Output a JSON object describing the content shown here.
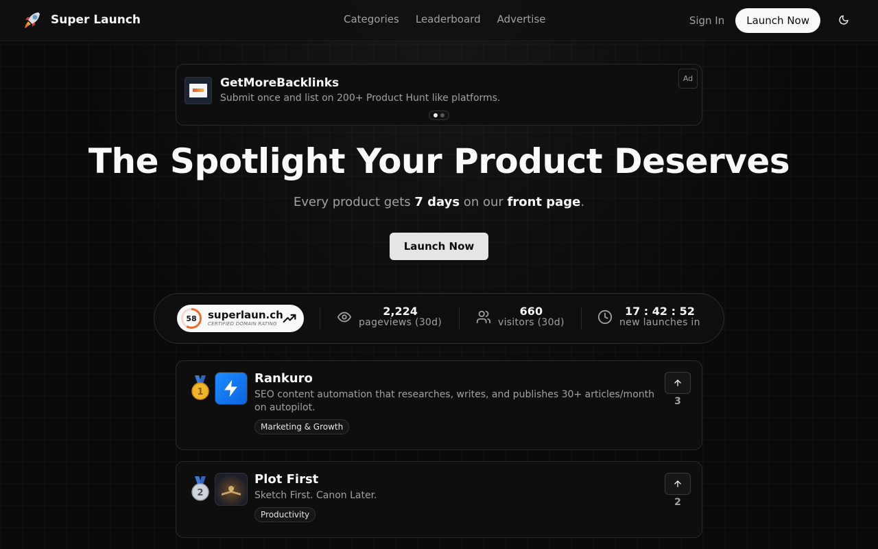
{
  "brand": {
    "name": "Super Launch",
    "logo_icon": "rocket-icon"
  },
  "nav": [
    {
      "label": "Categories"
    },
    {
      "label": "Leaderboard"
    },
    {
      "label": "Advertise"
    }
  ],
  "header": {
    "signin_label": "Sign In",
    "launch_label": "Launch Now",
    "theme_icon": "moon-icon"
  },
  "ad": {
    "title": "GetMoreBacklinks",
    "description": "Submit once and list on 200+ Product Hunt like platforms.",
    "badge": "Ad",
    "slides": 2,
    "active_slide": 1
  },
  "hero": {
    "title": "The Spotlight Your Product Deserves",
    "sub_pre": "Every product gets ",
    "sub_bold1": "7 days",
    "sub_mid": " on our ",
    "sub_bold2": "front page",
    "sub_post": ".",
    "cta": "Launch Now"
  },
  "stats": {
    "domain_rating": {
      "value": "58",
      "domain": "superlaun.ch",
      "caption": "CERTIFIED DOMAIN RATING"
    },
    "pageviews": {
      "value": "2,224",
      "label": "pageviews (30d)"
    },
    "visitors": {
      "value": "660",
      "label": "visitors (30d)"
    },
    "countdown": {
      "value": "17 : 42 : 52",
      "label": "new launches in"
    }
  },
  "products": [
    {
      "rank": "1",
      "name": "Rankuro",
      "description": "SEO content automation that researches, writes, and publishes 30+ articles/month on autopilot.",
      "tag": "Marketing & Growth",
      "votes": "3"
    },
    {
      "rank": "2",
      "name": "Plot First",
      "description": "Sketch First. Canon Later.",
      "tag": "Productivity",
      "votes": "2"
    }
  ],
  "colors": {
    "background": "#0a0a0a",
    "card": "#0e0e0e",
    "border": "#2a2a2a",
    "text": "#fafafa",
    "muted": "#a1a1a1",
    "accent_blue": "#1e8cff",
    "dr_ring": "#f06a2a"
  }
}
